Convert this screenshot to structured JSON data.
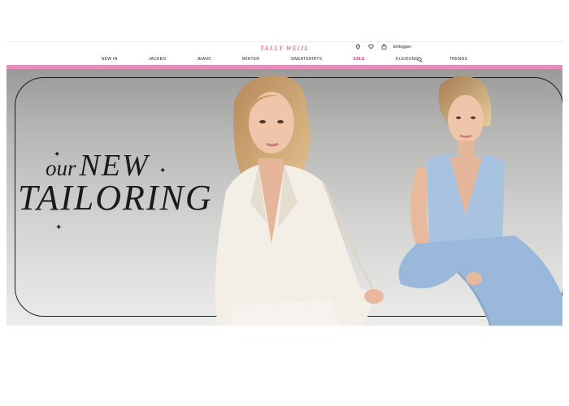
{
  "header": {
    "logo": "TALLY WEiJL",
    "login_label": "Einloggen",
    "icons": [
      "location-pin-icon",
      "heart-icon",
      "bag-icon",
      "search-icon"
    ]
  },
  "nav": {
    "items": [
      {
        "label": "NEW IN"
      },
      {
        "label": "JACKEN"
      },
      {
        "label": "JEANS"
      },
      {
        "label": "WINTER"
      },
      {
        "label": "SWEATSHIRTS"
      },
      {
        "label": "SALE"
      },
      {
        "label": "KLEIDUNG"
      },
      {
        "label": "TRENDS"
      }
    ]
  },
  "hero": {
    "headline_line1_a": "our",
    "headline_line1_b": "NEW",
    "headline_line2": "TAILORING"
  },
  "colors": {
    "brand_pink": "#e36aa6",
    "pink_bar": "#e88bbb",
    "sale": "#e02a7a"
  }
}
